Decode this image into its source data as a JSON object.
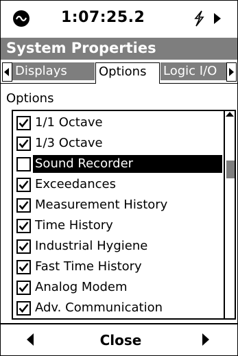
{
  "status": {
    "clock": "1:07:25.2",
    "logo_icon": "brand-logo-icon",
    "power_icon": "lightning-icon",
    "run_icon": "play-icon"
  },
  "window": {
    "title": "System Properties"
  },
  "tabs": [
    {
      "label": "Displays",
      "active": false
    },
    {
      "label": "Options",
      "active": true
    },
    {
      "label": "Logic I/O",
      "active": false
    }
  ],
  "section": {
    "label": "Options"
  },
  "options": [
    {
      "label": "1/1 Octave",
      "checked": true,
      "selected": false
    },
    {
      "label": "1/3 Octave",
      "checked": true,
      "selected": false
    },
    {
      "label": "Sound Recorder",
      "checked": false,
      "selected": true
    },
    {
      "label": "Exceedances",
      "checked": true,
      "selected": false
    },
    {
      "label": "Measurement History",
      "checked": true,
      "selected": false
    },
    {
      "label": "Time History",
      "checked": true,
      "selected": false
    },
    {
      "label": "Industrial Hygiene",
      "checked": true,
      "selected": false
    },
    {
      "label": "Fast Time History",
      "checked": true,
      "selected": false
    },
    {
      "label": "Analog Modem",
      "checked": true,
      "selected": false
    },
    {
      "label": "Adv. Communication",
      "checked": true,
      "selected": false
    }
  ],
  "footer": {
    "close_label": "Close"
  },
  "colors": {
    "accent_gray": "#7e7e7e",
    "foreground": "#000000",
    "background": "#ffffff"
  }
}
